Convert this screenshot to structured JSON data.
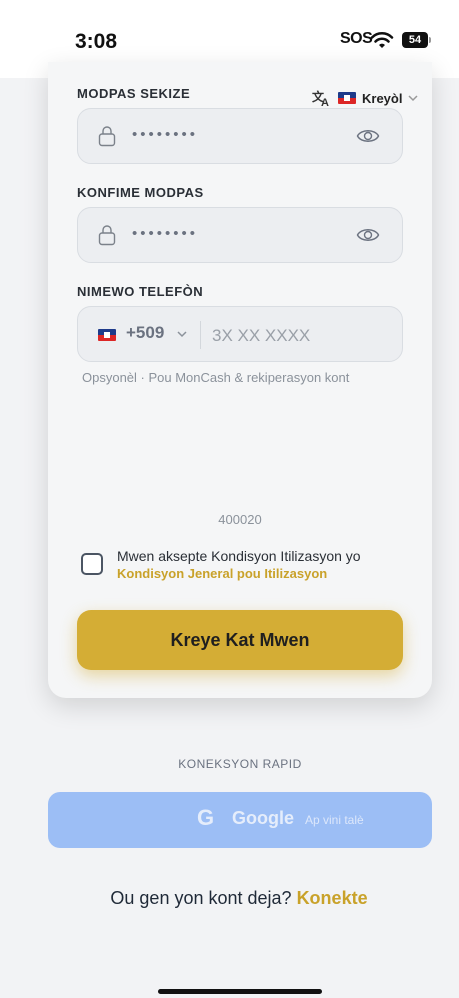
{
  "status_bar": {
    "time": "3:08",
    "sos": "SOS",
    "battery": "54"
  },
  "language": {
    "label": "Kreyòl",
    "icon": "translate-icon"
  },
  "password_confirm": {
    "label": "MODPAS SEKIZE",
    "value": "••••••••",
    "icon": "lock-icon"
  },
  "confirm_password": {
    "label": "KONFIME MODPAS",
    "value": "••••••••"
  },
  "phone": {
    "label": "NIMEWO TELEFÒN",
    "country_code": "+509",
    "placeholder": "3X XX XXXX",
    "hint": "Opsyonèl · Pou MonCash & rekiperasyon kont"
  },
  "code": "400020",
  "terms": {
    "text": "Mwen aksepte Kondisyon Itilizasyon yo",
    "link": "Kondisyon Jeneral pou Itilizasyon"
  },
  "primary_button": "Kreye Kat Mwen",
  "quick_login": {
    "label": "KONEKSYON RAPID",
    "google_label": "Google",
    "google_sub": "Ap vini talè"
  },
  "signin": {
    "text": "Ou gen yon kont deja?",
    "link": "Konekte"
  },
  "colors": {
    "accent": "#d4ad35",
    "google": "#9cbef5"
  }
}
